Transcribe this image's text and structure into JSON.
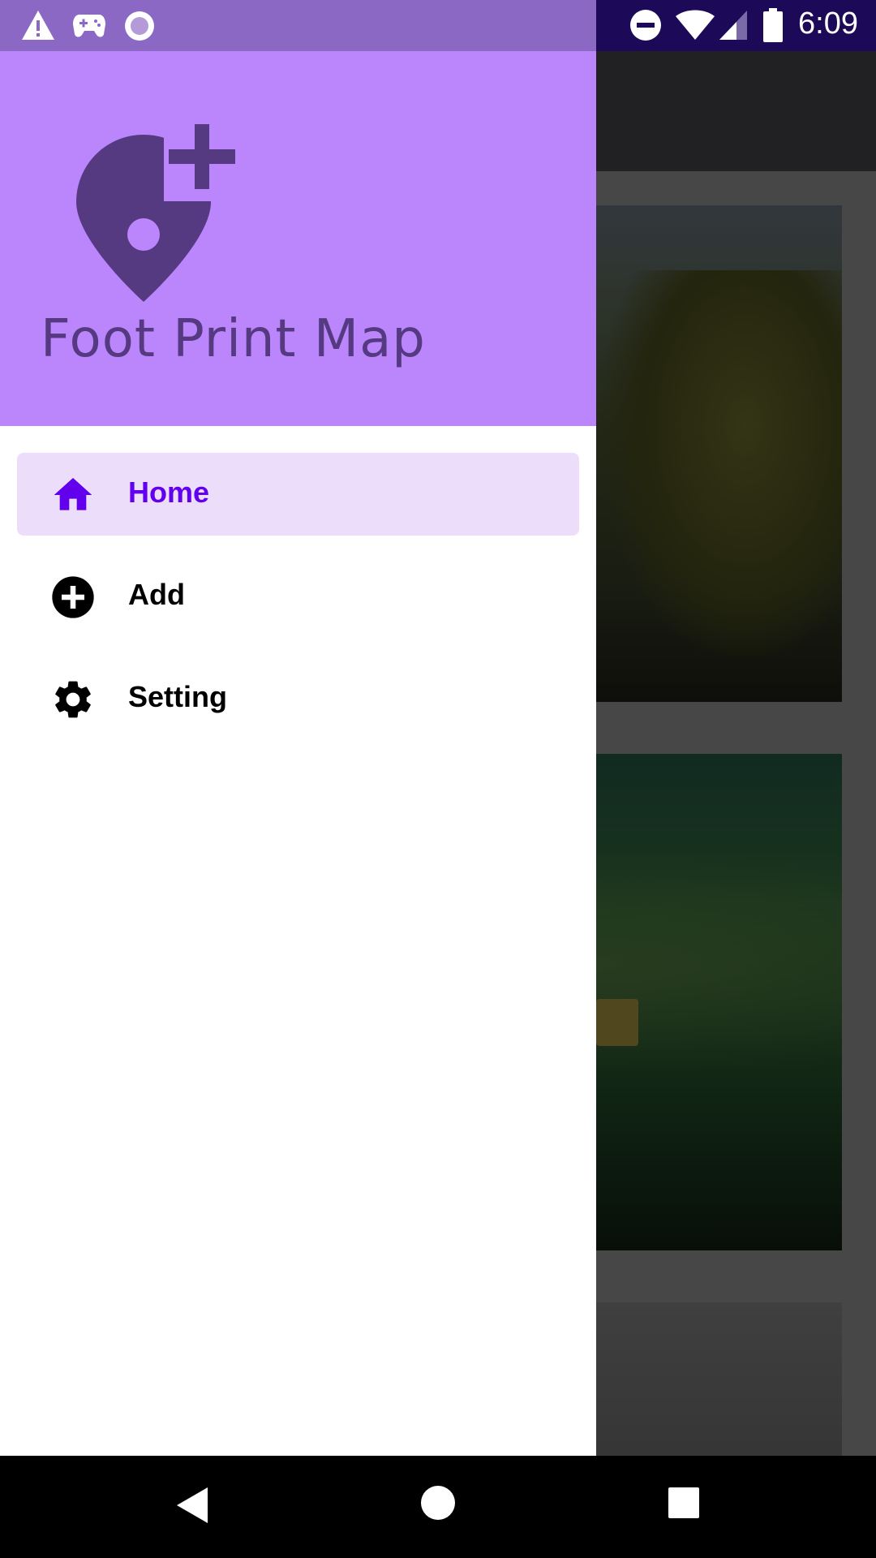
{
  "status_bar": {
    "time": "6:09",
    "left_icons": [
      "warning-icon",
      "gamepad-icon",
      "record-icon"
    ],
    "right_icons": [
      "do-not-disturb-icon",
      "wifi-icon",
      "signal-icon",
      "battery-icon"
    ]
  },
  "drawer": {
    "app_name": "Foot Print Map",
    "header_color": "#bb86fc",
    "items": [
      {
        "label": "Home",
        "icon": "home-icon",
        "selected": true
      },
      {
        "label": "Add",
        "icon": "add-circle-icon",
        "selected": false
      },
      {
        "label": "Setting",
        "icon": "gear-icon",
        "selected": false
      }
    ]
  },
  "colors": {
    "accent": "#6200ee",
    "selected_background": "#ecdefb",
    "logo": "#553a82"
  },
  "nav_bar": {
    "buttons": [
      "back-icon",
      "home-circle-icon",
      "recents-icon"
    ]
  }
}
